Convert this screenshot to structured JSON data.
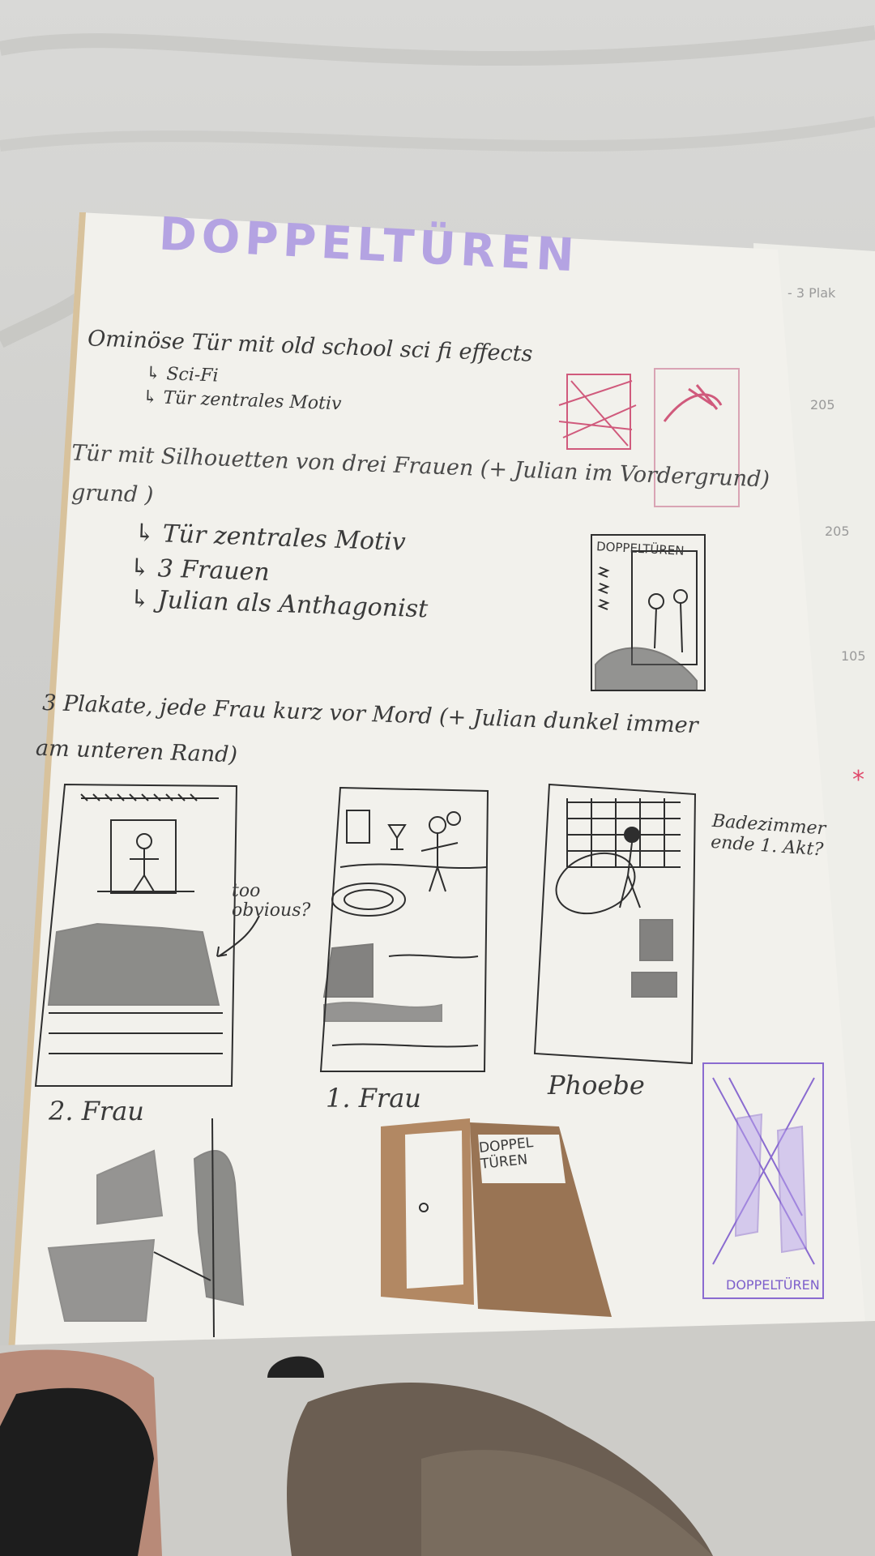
{
  "title": "DOPPELTÜREN",
  "idea1": {
    "heading": "Ominöse Tür mit old school sci fi effects",
    "points": [
      "↳ Sci-Fi",
      "↳ Tür zentrales Motiv"
    ]
  },
  "idea2": {
    "heading_line1": "Tür mit Silhouetten von drei Frauen (+ Julian im Vordergrund)",
    "heading_line2": "grund )",
    "vordergrund_fragment": "Vordergrund",
    "points": [
      "↳ Tür zentrales Motiv",
      "↳ 3 Frauen",
      "↳ Julian als Anthagonist"
    ],
    "thumbnail_title": "DOPPELTÜREN"
  },
  "idea3": {
    "heading_line1": "3 Plakate, jede Frau kurz vor Mord (+ Julian dunkel immer",
    "heading_line2": "am unteren Rand)",
    "annotation": "too obvious?",
    "side_note": "Badezimmer ende 1. Akt?",
    "captions": [
      "2. Frau",
      "1. Frau",
      "Phoebe"
    ]
  },
  "bottom": {
    "door_title": "DOPPEL TÜREN",
    "purple_title": "DOPPELTÜREN"
  },
  "next_page_fragments": [
    "- 3 Plak",
    "205",
    "205",
    "105"
  ],
  "colors": {
    "paper": "#f2f1ec",
    "ink": "#2e2e2e",
    "title_purple": "#b4a3e2",
    "pink": "#d05a7c",
    "brown": "#8a5e3a",
    "violet": "#8a6bd0"
  }
}
